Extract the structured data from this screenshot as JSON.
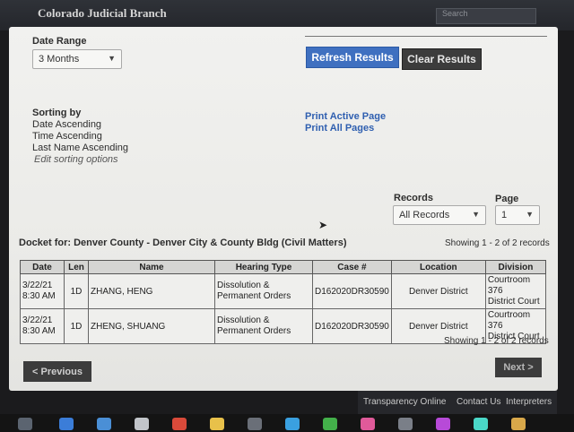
{
  "header": {
    "brand": "Colorado Judicial Branch",
    "search_placeholder": "Search"
  },
  "filters": {
    "date_range_label": "Date Range",
    "date_range_value": "3 Months",
    "refresh_label": "Refresh Results",
    "clear_label": "Clear Results"
  },
  "sorting": {
    "title": "Sorting by",
    "items": [
      "Date Ascending",
      "Time Ascending",
      "Last Name Ascending"
    ],
    "edit_label": "Edit sorting options"
  },
  "print": {
    "active_page": "Print Active Page",
    "all_pages": "Print All Pages"
  },
  "pager": {
    "records_label": "Records",
    "records_value": "All Records",
    "page_label": "Page",
    "page_value": "1",
    "showing": "Showing 1 - 2 of 2 records",
    "prev_label": "< Previous",
    "next_label": "Next >"
  },
  "docket": {
    "title": "Docket for: Denver County - Denver City & County Bldg (Civil Matters)",
    "columns": [
      "Date",
      "Len",
      "Name",
      "Hearing Type",
      "Case #",
      "Location",
      "Division"
    ],
    "rows": [
      {
        "date_1": "3/22/21",
        "date_2": "8:30 AM",
        "len": "1D",
        "name": "ZHANG, HENG",
        "hearing_1": "Dissolution &",
        "hearing_2": "Permanent Orders",
        "case": "D162020DR30590",
        "location": "Denver District",
        "division_1": "Courtroom 376",
        "division_2": "District Court"
      },
      {
        "date_1": "3/22/21",
        "date_2": "8:30 AM",
        "len": "1D",
        "name": "ZHENG, SHUANG",
        "hearing_1": "Dissolution &",
        "hearing_2": "Permanent Orders",
        "case": "D162020DR30590",
        "location": "Denver District",
        "division_1": "Courtroom 376",
        "division_2": "District Court"
      }
    ]
  },
  "footer": {
    "transparency": "Transparency Online",
    "contact": "Contact Us",
    "more": "Interpreters"
  },
  "colors": {
    "accent": "#3f70c0",
    "dark_button": "#3c3c3c",
    "link": "#2f5fb0"
  }
}
